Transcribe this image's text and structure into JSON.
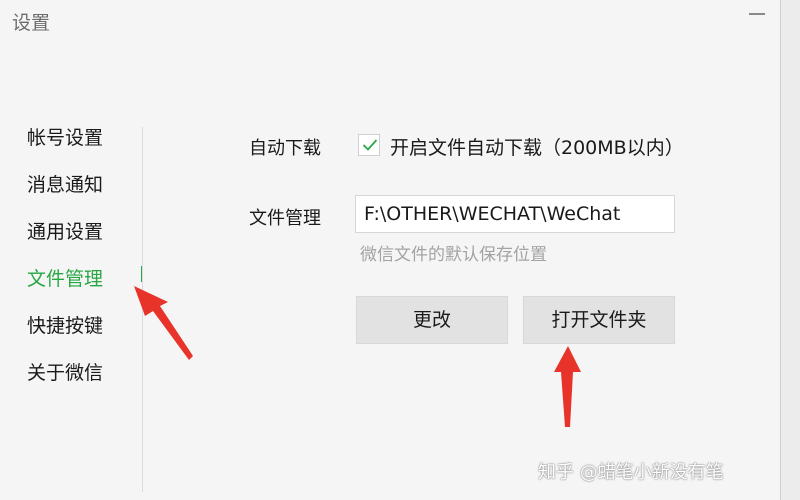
{
  "window": {
    "title": "设置"
  },
  "sidebar": {
    "items": [
      {
        "label": "帐号设置"
      },
      {
        "label": "消息通知"
      },
      {
        "label": "通用设置"
      },
      {
        "label": "文件管理",
        "active": true
      },
      {
        "label": "快捷按键"
      },
      {
        "label": "关于微信"
      }
    ]
  },
  "file_settings": {
    "auto_download_label": "自动下载",
    "auto_download_checkbox_label": "开启文件自动下载（200MB以内）",
    "auto_download_checked": true,
    "file_management_label": "文件管理",
    "path_value": "F:\\OTHER\\WECHAT\\WeChat",
    "path_hint": "微信文件的默认保存位置",
    "change_button": "更改",
    "open_folder_button": "打开文件夹"
  },
  "watermark": "知乎 @蜡笔小新没有笔",
  "colors": {
    "accent": "#27a844",
    "annotation_arrow": "#e8332a",
    "window_bg": "#f5f5f5",
    "button_bg": "#e2e2e2",
    "hint_text": "#a3a3a3"
  },
  "icons": {
    "checkbox": "checkmark-icon",
    "minimize": "minimize-icon",
    "annotation": "red-arrow-icon"
  }
}
